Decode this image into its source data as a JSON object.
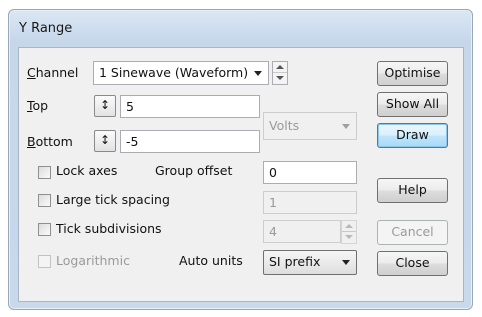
{
  "window": {
    "title": "Y Range"
  },
  "channel": {
    "label": "Channel",
    "value": "1 Sinewave (Waveform)"
  },
  "top": {
    "label": "Top",
    "value": "5",
    "icon_glyph": "↕"
  },
  "bottom": {
    "label": "Bottom",
    "value": "-5",
    "icon_glyph": "↕"
  },
  "units": {
    "value": "Volts"
  },
  "options": {
    "lock_axes": {
      "label": "Lock axes",
      "checked": false
    },
    "group_offset": {
      "label": "Group offset",
      "value": "0"
    },
    "large_tick_spacing": {
      "label": "Large tick spacing",
      "checked": false,
      "value": "1"
    },
    "tick_subdivisions": {
      "label": "Tick subdivisions",
      "checked": false,
      "value": "4"
    },
    "logarithmic": {
      "label": "Logarithmic",
      "checked": false
    },
    "auto_units": {
      "label": "Auto units",
      "value": "SI prefix"
    }
  },
  "buttons": {
    "optimise": "Optimise",
    "show_all": "Show All",
    "draw": "Draw",
    "help": "Help",
    "cancel": "Cancel",
    "close": "Close"
  },
  "colors": {
    "frame": "#c9d9ec",
    "client": "#f0f0f0",
    "default_button": "#bee6fd",
    "disabled_text": "#9a9a9a"
  }
}
